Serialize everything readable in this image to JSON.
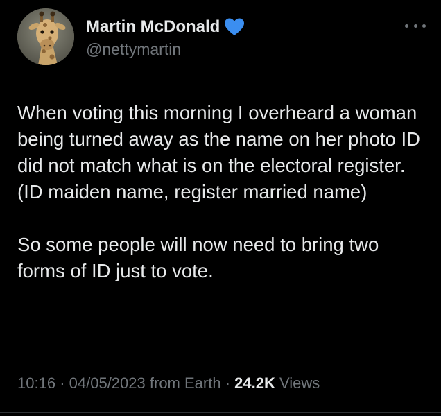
{
  "author": {
    "display_name": "Martin McDonald",
    "handle": "@nettymartin",
    "avatar_icon": "giraffe-avatar",
    "badge_icon": "blue-heart-icon",
    "badge_color": "#3b8ef0"
  },
  "menu": {
    "icon": "more-options-icon"
  },
  "tweet": {
    "paragraphs": [
      "When voting this morning I overheard a woman being turned away as the name on her photo ID did not match what is on the electoral register.(ID maiden name, register married name)",
      "So some people will now need to bring two forms of ID just to vote."
    ]
  },
  "meta": {
    "time": "10:16",
    "separator": "·",
    "date": "04/05/2023",
    "source": "from Earth",
    "views_count": "24.2K",
    "views_label": "Views"
  },
  "colors": {
    "background": "#000000",
    "primary_text": "#e7e9ea",
    "secondary_text": "#71767b"
  }
}
